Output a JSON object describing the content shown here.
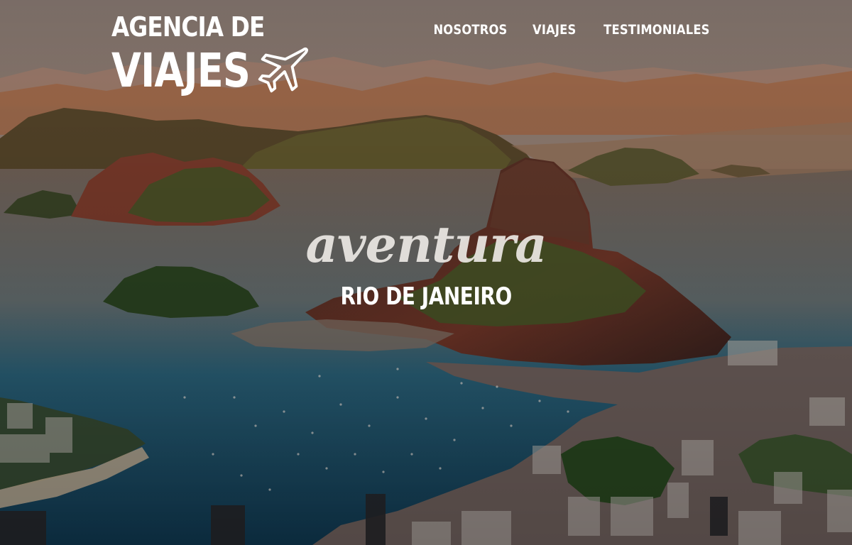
{
  "brand": {
    "line1": "AGENCIA DE",
    "line2": "VIAJES",
    "icon": "plane-icon"
  },
  "nav": {
    "items": [
      {
        "label": "NOSOTROS"
      },
      {
        "label": "VIAJES"
      },
      {
        "label": "TESTIMONIALES"
      }
    ]
  },
  "hero": {
    "tagline": "aventura",
    "destination": "RIO DE JANEIRO"
  },
  "colors": {
    "text": "#ffffff",
    "sky": "#b89a88",
    "water": "#1f5f78",
    "mountain": "#6b3a2a"
  }
}
